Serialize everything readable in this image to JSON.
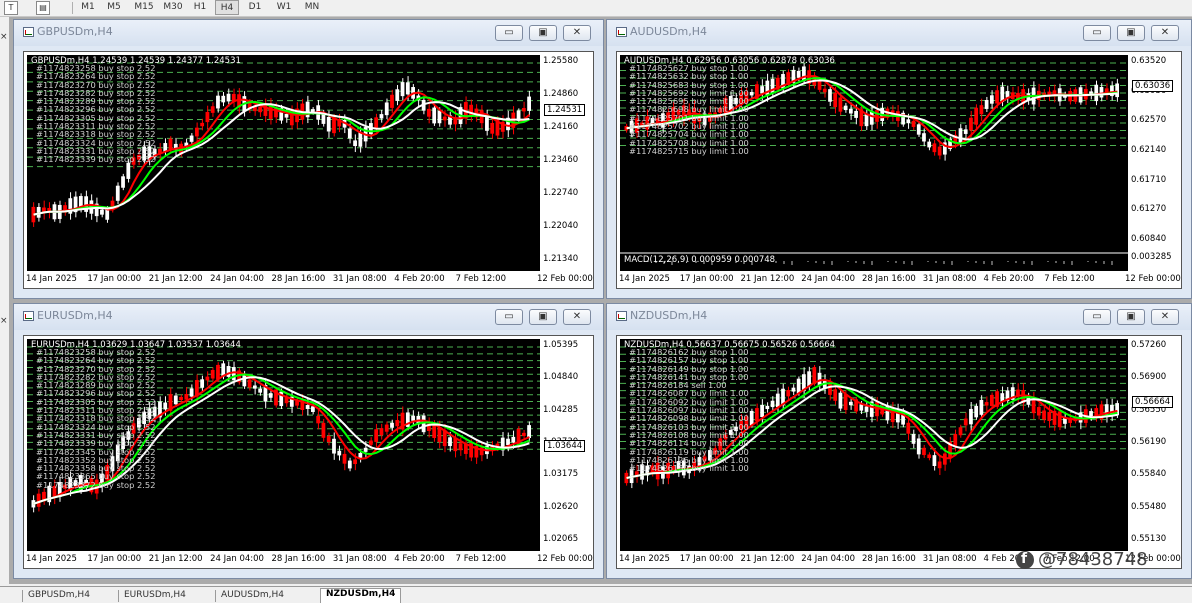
{
  "toolbar": {
    "timeframes": [
      "M1",
      "M5",
      "M15",
      "M30",
      "H1",
      "H4",
      "D1",
      "W1",
      "MN"
    ],
    "active_timeframe": "H4"
  },
  "colors": {
    "bull": "#ffffff",
    "bear": "#ff0000",
    "grid_green": "#4caf50",
    "ma_red": "#ff0000",
    "ma_green": "#00ff00",
    "ma_white": "#ffffff"
  },
  "windows": [
    {
      "id": "gbp",
      "title": "GBPUSDm,H4",
      "header": "GBPUSDm,H4  1.24539 1.24539 1.24377 1.24531",
      "price_axis": [
        "1.25580",
        "1.24860",
        "1.24160",
        "1.23460",
        "1.22740",
        "1.22040",
        "1.21340"
      ],
      "current_price": "1.24531",
      "date_axis": [
        "14 Jan 2025",
        "17 Jan 00:00",
        "21 Jan 12:00",
        "24 Jan 04:00",
        "28 Jan 16:00",
        "31 Jan 08:00",
        "4 Feb 20:00",
        "7 Feb 12:00",
        "12 Feb 00:00"
      ],
      "orders": [
        "#1174823258 buy stop 2.52",
        "#1174823264 buy stop 2.52",
        "#1174823270 buy stop 2.52",
        "#1174823282 buy stop 2.52",
        "#1174823289 buy stop 2.52",
        "#1174823296 buy stop 2.52",
        "#1174823305 buy stop 2.52",
        "#1174823311 buy stop 2.52",
        "#1174823318 buy stop 2.52",
        "#1174823324 buy stop 2.52",
        "#1174823331 buy stop 2.52",
        "#1174823339 buy stop 2.52"
      ],
      "macd": ""
    },
    {
      "id": "aud",
      "title": "AUDUSDm,H4",
      "header": "AUDUSDm,H4  0.62956 0.63056 0.62878 0.63036",
      "price_axis": [
        "0.63520",
        "0.63036",
        "0.62570",
        "0.62140",
        "0.61710",
        "0.61270",
        "0.60840"
      ],
      "current_price": "0.63036",
      "date_axis": [
        "14 Jan 2025",
        "17 Jan 00:00",
        "21 Jan 12:00",
        "24 Jan 04:00",
        "28 Jan 16:00",
        "31 Jan 08:00",
        "4 Feb 20:00",
        "7 Feb 12:00",
        "12 Feb 00:00"
      ],
      "orders": [
        "#1174825627 buy stop 1.00",
        "#1174825632 buy stop 1.00",
        "#1174825683 buy stop 1.00",
        "#1174825692 buy limit 1.00",
        "#1174825695 buy limit 1.00",
        "#1174825698 buy limit 1.00",
        "#1174825701 buy limit 1.00",
        "#1174825702 buy limit 1.00",
        "#1174825704 buy limit 1.00",
        "#1174825708 buy limit 1.00",
        "#1174825715 buy limit 1.00"
      ],
      "macd": "MACD(12,26,9) 0.000959 0.000748",
      "macd_value": "0.003285"
    },
    {
      "id": "eur",
      "title": "EURUSDm,H4",
      "header": "EURUSDm,H4  1.03629 1.03647 1.03537 1.03644",
      "price_axis": [
        "1.05395",
        "1.04840",
        "1.04285",
        "1.03730",
        "1.03175",
        "1.02620",
        "1.02065"
      ],
      "current_price": "1.03644",
      "date_axis": [
        "14 Jan 2025",
        "17 Jan 00:00",
        "21 Jan 12:00",
        "24 Jan 04:00",
        "28 Jan 16:00",
        "31 Jan 08:00",
        "4 Feb 20:00",
        "7 Feb 12:00",
        "12 Feb 00:00"
      ],
      "orders": [
        "#1174823258 buy stop 2.52",
        "#1174823264 buy stop 2.52",
        "#1174823270 buy stop 2.52",
        "#1174823282 buy stop 2.52",
        "#1174823289 buy stop 2.52",
        "#1174823296 buy stop 2.52",
        "#1174823305 buy stop 2.52",
        "#1174823311 buy stop 2.52",
        "#1174823318 buy stop 2.52",
        "#1174823324 buy stop 2.52",
        "#1174823331 buy stop 2.52",
        "#1174823339 buy stop 2.52",
        "#1174823345 buy stop 2.52",
        "#1174823352 buy stop 2.52",
        "#1174823358 buy stop 2.52",
        "#1174823365 buy stop 2.52",
        "#1174823372 buy stop 2.52"
      ],
      "macd": ""
    },
    {
      "id": "nzd",
      "title": "NZDUSDm,H4",
      "header": "NZDUSDm,H4  0.56637 0.56675 0.56526 0.56664",
      "price_axis": [
        "0.57260",
        "0.56900",
        "0.56550",
        "0.56190",
        "0.55840",
        "0.55480",
        "0.55130"
      ],
      "current_price": "0.56664",
      "date_axis": [
        "14 Jan 2025",
        "17 Jan 00:00",
        "21 Jan 12:00",
        "24 Jan 04:00",
        "28 Jan 16:00",
        "31 Jan 08:00",
        "4 Feb 20:00",
        "7 Feb 12:00",
        "12 Feb 00:00"
      ],
      "orders": [
        "#1174826162 buy stop 1.00",
        "#1174826157 buy stop 1.00",
        "#1174826149 buy stop 1.00",
        "#1174826141 buy stop 1.00",
        "#1174826184 sell 1.00",
        "#1174826087 buy limit 1.00",
        "#1174826092 buy limit 1.00",
        "#1174826097 buy limit 1.00",
        "#1174826098 buy limit 1.00",
        "#1174826103 buy limit 1.00",
        "#1174826108 buy limit 1.00",
        "#1174826114 buy limit 1.00",
        "#1174826119 buy limit 1.00",
        "#1174826126 buy limit 1.00",
        "#1174826130 buy limit 1.00"
      ],
      "macd": ""
    }
  ],
  "tabs": [
    "GBPUSDm,H4",
    "EURUSDm,H4",
    "AUDUSDm,H4",
    "NZDUSDm,H4"
  ],
  "active_tab": "NZDUSDm,H4",
  "watermark": "@78438748"
}
